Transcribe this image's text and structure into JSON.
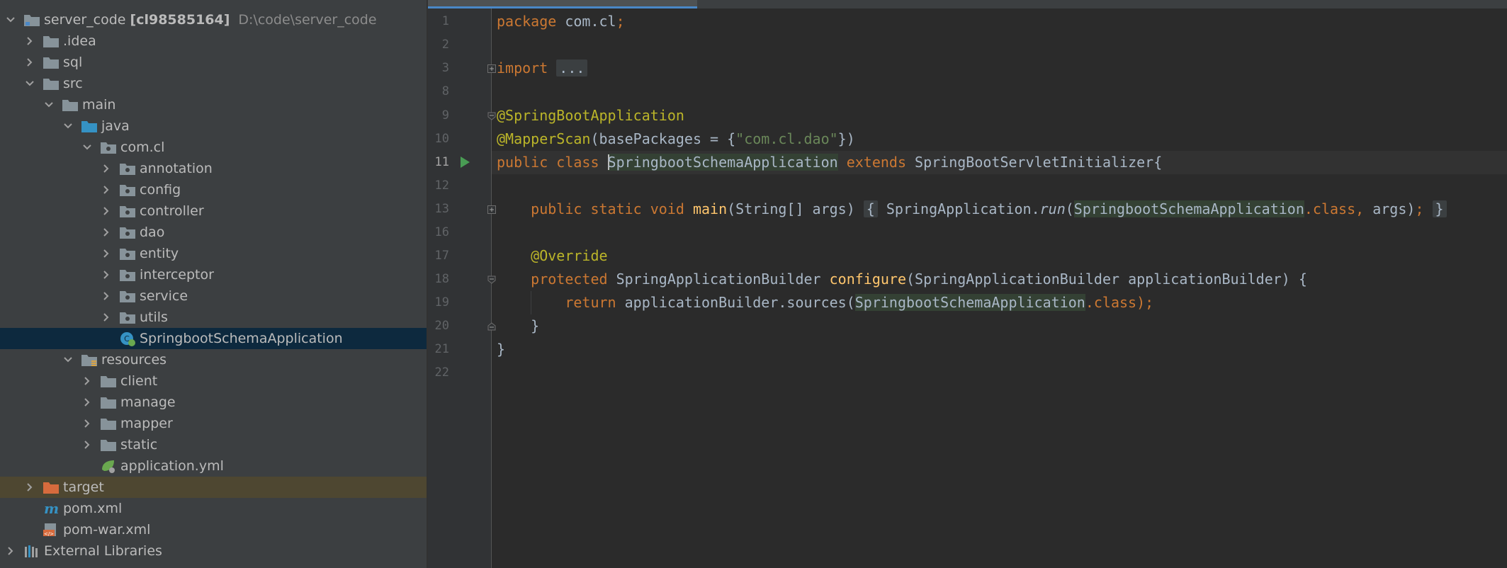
{
  "colors": {
    "panel_bg": "#3c3f41",
    "editor_bg": "#2b2b2b",
    "gutter_bg": "#313335",
    "selected_row": "#0d293e",
    "excluded_row": "#4e4731",
    "keyword": "#cc7832",
    "annotation": "#bbb529",
    "string": "#6a8759",
    "method_decl": "#ffc66d",
    "plain": "#a9b7c6",
    "tab_underline": "#4a88c7"
  },
  "project_tree": {
    "root": {
      "name": "server_code",
      "module": "[cl98585164]",
      "path": "D:\\code\\server_code"
    },
    "idea": ".idea",
    "sql": "sql",
    "src": "src",
    "main": "main",
    "java": "java",
    "package": "com.cl",
    "packages": [
      "annotation",
      "config",
      "controller",
      "dao",
      "entity",
      "interceptor",
      "service",
      "utils"
    ],
    "main_class": "SpringbootSchemaApplication",
    "resources": "resources",
    "resource_dirs": [
      "client",
      "manage",
      "mapper",
      "static"
    ],
    "app_config": "application.yml",
    "target": "target",
    "pom": "pom.xml",
    "pom_war": "pom-war.xml",
    "external_libs": "External Libraries"
  },
  "editor": {
    "current_line": "11",
    "line_numbers": [
      "1",
      "2",
      "3",
      "8",
      "9",
      "10",
      "11",
      "12",
      "13",
      "16",
      "17",
      "18",
      "19",
      "20",
      "21",
      "22"
    ],
    "code": {
      "l1_kw": "package",
      "l1_pkg": " com.cl",
      "l1_semi": ";",
      "l3_kw": "import",
      "l3_fold": "...",
      "l9_ann": "@SpringBootApplication",
      "l10_ann": "@MapperScan",
      "l10_mid": "(basePackages = {",
      "l10_str": "\"com.cl.dao\"",
      "l10_end": "})",
      "l11_kw": "public class ",
      "l11_s": "S",
      "l11_cls": "pringbootSchemaApplication",
      "l11_ext": " extends ",
      "l11_sup": "SpringBootServletInitializer{",
      "l13_kw": "public static void ",
      "l13_fn": "main",
      "l13_sig": "(String[] args) ",
      "l13_fold_open": "{",
      "l13_call": " SpringApplication.",
      "l13_run": "run",
      "l13_paren": "(",
      "l13_cls": "SpringbootSchemaApplication",
      "l13_dotclass": ".class, ",
      "l13_args": "args)",
      "l13_semi": ";",
      "l13_fold_close": "}",
      "l17_ann": "@Override",
      "l18_kw": "protected ",
      "l18_type": "SpringApplicationBuilder ",
      "l18_fn": "configure",
      "l18_rest": "(SpringApplicationBuilder applicationBuilder) {",
      "l19_kw": "return ",
      "l19_call": "applicationBuilder.sources(",
      "l19_cls": "SpringbootSchemaApplication",
      "l19_dotclass": ".class",
      "l19_end": ");",
      "l20": "}",
      "l21": "}"
    }
  }
}
